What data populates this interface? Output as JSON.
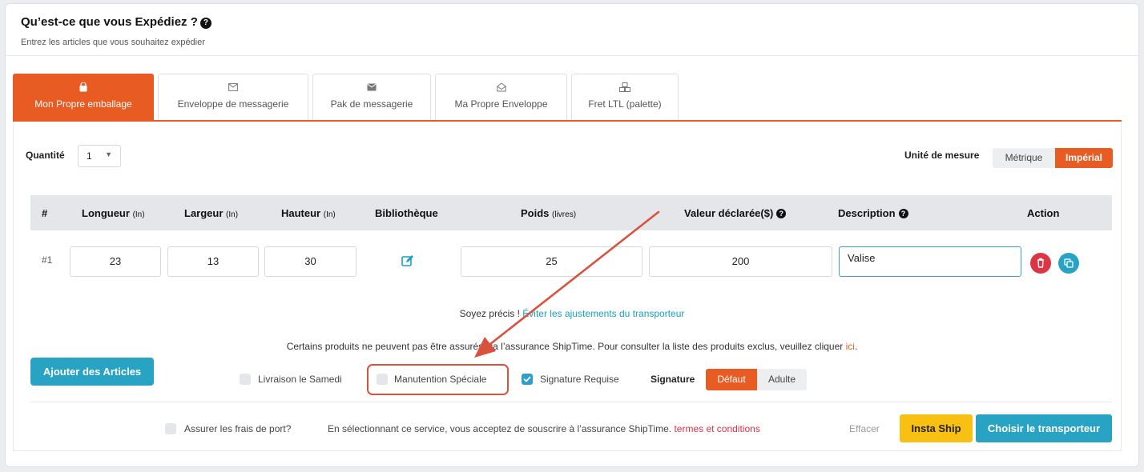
{
  "header": {
    "title": "Qu’est-ce que vous Expédiez ?",
    "subtitle": "Entrez les articles que vous souhaitez expédier"
  },
  "tabs": [
    {
      "label": "Mon Propre emballage",
      "icon": "bag-icon",
      "active": true
    },
    {
      "label": "Enveloppe de messagerie",
      "icon": "envelope-outline-icon"
    },
    {
      "label": "Pak de messagerie",
      "icon": "envelope-solid-icon"
    },
    {
      "label": "Ma Propre Enveloppe",
      "icon": "envelope-open-icon"
    },
    {
      "label": "Fret LTL (palette)",
      "icon": "cubes-icon"
    }
  ],
  "quantity": {
    "label": "Quantité",
    "value": "1"
  },
  "units": {
    "label": "Unité de mesure",
    "metric": "Métrique",
    "imperial": "Impérial",
    "selected": "Impérial"
  },
  "table": {
    "headers": {
      "num": "#",
      "length": "Longueur",
      "length_unit": "(In)",
      "width": "Largeur",
      "width_unit": "(In)",
      "height": "Hauteur",
      "height_unit": "(In)",
      "library": "Bibliothèque",
      "weight": "Poids",
      "weight_unit": "(livres)",
      "declared": "Valeur déclarée($)",
      "description": "Description",
      "action": "Action"
    },
    "rows": [
      {
        "num": "#1",
        "length": "23",
        "width": "13",
        "height": "30",
        "weight": "25",
        "declared": "200",
        "description": "Valise"
      }
    ]
  },
  "precise": {
    "text": "Soyez précis ! ",
    "link": "Éviter les ajustements du transporteur"
  },
  "notice": {
    "text": "Certains produits ne peuvent pas être assurés via l’assurance ShipTime. Pour consulter la liste des produits exclus, veuillez cliquer ",
    "link": "ici",
    "end": "."
  },
  "add_button": "Ajouter des Articles",
  "options": {
    "saturday": {
      "label": "Livraison le Samedi",
      "checked": false
    },
    "special": {
      "label": "Manutention Spéciale",
      "checked": false
    },
    "signature": {
      "label": "Signature Requise",
      "checked": true
    }
  },
  "signature": {
    "label": "Signature",
    "default": "Défaut",
    "adult": "Adulte",
    "selected": "Défaut"
  },
  "insurance": {
    "label": "Assurer les frais de port?",
    "checked": false,
    "text": "En sélectionnant ce service, vous acceptez de souscrire à l’assurance ShipTime. ",
    "link": "termes et conditions"
  },
  "footer": {
    "clear": "Effacer",
    "insta": "Insta Ship",
    "choose": "Choisir le transporteur"
  },
  "colors": {
    "accent": "#e85c24",
    "teal": "#29a3c4",
    "yellow": "#f8c012",
    "danger": "#dc3545",
    "annotation": "#d9523d"
  }
}
